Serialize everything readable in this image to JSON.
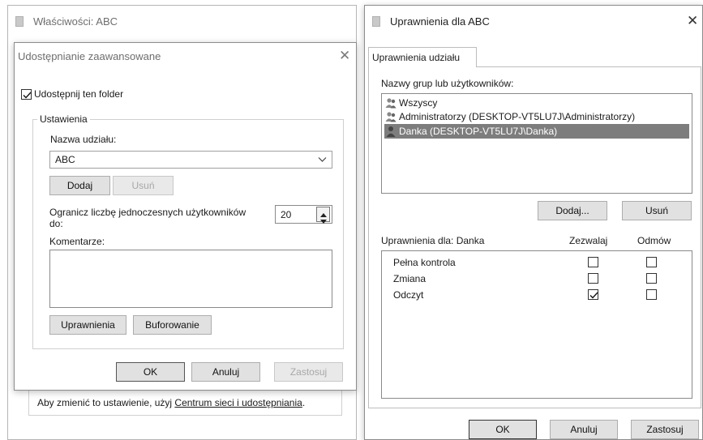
{
  "properties_window": {
    "title": "Właściwości: ABC",
    "footer_text": "Aby zmienić to ustawienie, użyj ",
    "footer_link": "Centrum sieci i udostępniania",
    "footer_period": "."
  },
  "advanced_sharing": {
    "title": "Udostępnianie zaawansowane",
    "share_checkbox_label": "Udostępnij ten folder",
    "share_checked": true,
    "settings_group": "Ustawienia",
    "share_name_label": "Nazwa udziału:",
    "share_name_value": "ABC",
    "add_button": "Dodaj",
    "remove_button": "Usuń",
    "limit_label_line1": "Ogranicz liczbę jednoczesnych użytkowników",
    "limit_label_line2": "do:",
    "limit_value": "20",
    "comments_label": "Komentarze:",
    "comments_value": "",
    "permissions_button": "Uprawnienia",
    "caching_button": "Buforowanie",
    "ok_button": "OK",
    "cancel_button": "Anuluj",
    "apply_button": "Zastosuj"
  },
  "permissions_window": {
    "title": "Uprawnienia dla ABC",
    "tab_label": "Uprawnienia udziału",
    "users_label": "Nazwy grup lub użytkowników:",
    "users": [
      {
        "name": "Wszyscy",
        "icon": "group-icon",
        "selected": false
      },
      {
        "name": "Administratorzy (DESKTOP-VT5LU7J\\Administratorzy)",
        "icon": "group-icon",
        "selected": false
      },
      {
        "name": "Danka (DESKTOP-VT5LU7J\\Danka)",
        "icon": "user-icon",
        "selected": true
      }
    ],
    "add_button": "Dodaj...",
    "remove_button": "Usuń",
    "perm_header": "Uprawnienia dla: Danka",
    "allow_header": "Zezwalaj",
    "deny_header": "Odmów",
    "permissions": [
      {
        "name": "Pełna kontrola",
        "allow": false,
        "deny": false
      },
      {
        "name": "Zmiana",
        "allow": false,
        "deny": false
      },
      {
        "name": "Odczyt",
        "allow": true,
        "deny": false
      }
    ],
    "ok_button": "OK",
    "cancel_button": "Anuluj",
    "apply_button": "Zastosuj"
  },
  "colors": {
    "selection": "#7d7d7d",
    "button_face": "#e1e1e1",
    "link": "#1a1a1a"
  }
}
